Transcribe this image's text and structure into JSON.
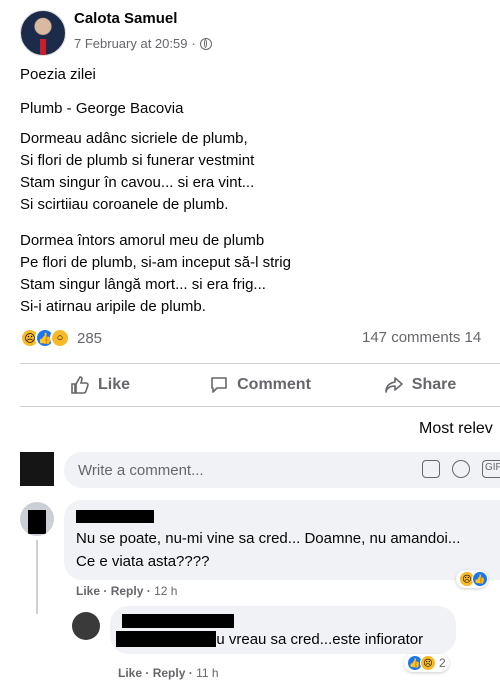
{
  "post": {
    "author": "Calota Samuel",
    "timestamp": "7 February at 20:59",
    "separator": "·",
    "privacy_icon": "globe-icon",
    "lines": {
      "intro": "Poezia zilei",
      "title": "Plumb - George Bacovia",
      "stanza1": [
        "Dormeau adânc sicriele de plumb,",
        "Si flori de plumb si funerar vestmint",
        "Stam singur în cavou... si era vint...",
        "Si scirtiiau coroanele de plumb."
      ],
      "stanza2": [
        "Dormea întors amorul meu de plumb",
        "Pe flori de plumb, si-am inceput să-l strig",
        "Stam singur lângă mort... si era frig...",
        "Si-i atirnau aripile de plumb."
      ]
    },
    "reaction_count": "285",
    "comments_text": "147 comments  14"
  },
  "actions": {
    "like": "Like",
    "comment": "Comment",
    "share": "Share"
  },
  "sort_label": "Most relev",
  "composer": {
    "placeholder": "Write a comment...",
    "gif_label": "GIF"
  },
  "comments": [
    {
      "text_line1": "Nu se poate, nu-mi vine sa cred... Doamne, nu amandoi...",
      "text_line2": "Ce e viata asta????",
      "like_label": "Like",
      "reply_label": "Reply",
      "dot": "·",
      "time": "12 h"
    },
    {
      "text": "nu vreau sa cred...este infiorator",
      "like_label": "Like",
      "reply_label": "Reply",
      "dot": "·",
      "time": "11 h",
      "reaction_count": "2"
    }
  ],
  "colors": {
    "like_blue": "#1877f2",
    "reaction_yellow": "#f7b928",
    "secondary_text": "#65676b",
    "bubble_bg": "#f0f2f5"
  }
}
